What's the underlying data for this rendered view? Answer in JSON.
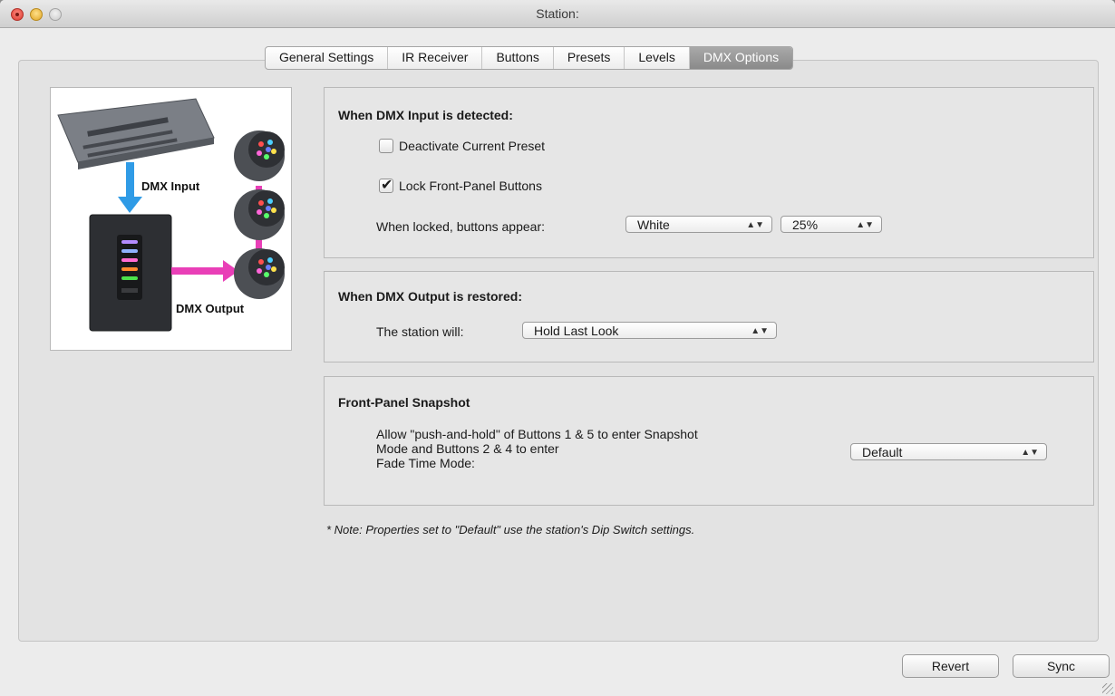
{
  "window": {
    "title": "Station:"
  },
  "tabs": [
    {
      "label": "General Settings",
      "active": false
    },
    {
      "label": "IR Receiver",
      "active": false
    },
    {
      "label": "Buttons",
      "active": false
    },
    {
      "label": "Presets",
      "active": false
    },
    {
      "label": "Levels",
      "active": false
    },
    {
      "label": "DMX Options",
      "active": true
    }
  ],
  "diagram": {
    "dmx_input_label": "DMX Input",
    "dmx_output_label": "DMX Output",
    "colors": {
      "input_arrow": "#2f9be6",
      "output_arrow": "#e93fb7"
    }
  },
  "dmx_input_group": {
    "title": "When DMX Input is detected:",
    "deactivate_preset": {
      "label": "Deactivate Current Preset",
      "checked": false
    },
    "lock_buttons": {
      "label": "Lock Front-Panel Buttons",
      "checked": true
    },
    "locked_appearance_label": "When locked, buttons appear:",
    "color_select": {
      "value": "White"
    },
    "level_select": {
      "value": "25%"
    }
  },
  "dmx_output_group": {
    "title": "When DMX Output is restored:",
    "station_label": "The station will:",
    "action_select": {
      "value": "Hold Last Look"
    }
  },
  "snapshot_group": {
    "title": "Front-Panel Snapshot",
    "description_lines": [
      "Allow \"push-and-hold\" of Buttons 1 & 5 to enter Snapshot",
      "Mode and Buttons 2 & 4 to enter",
      "Fade Time Mode:"
    ],
    "mode_select": {
      "value": "Default"
    }
  },
  "note": "* Note: Properties set to \"Default\" use the station's Dip Switch settings.",
  "footer": {
    "revert_label": "Revert",
    "sync_label": "Sync"
  }
}
